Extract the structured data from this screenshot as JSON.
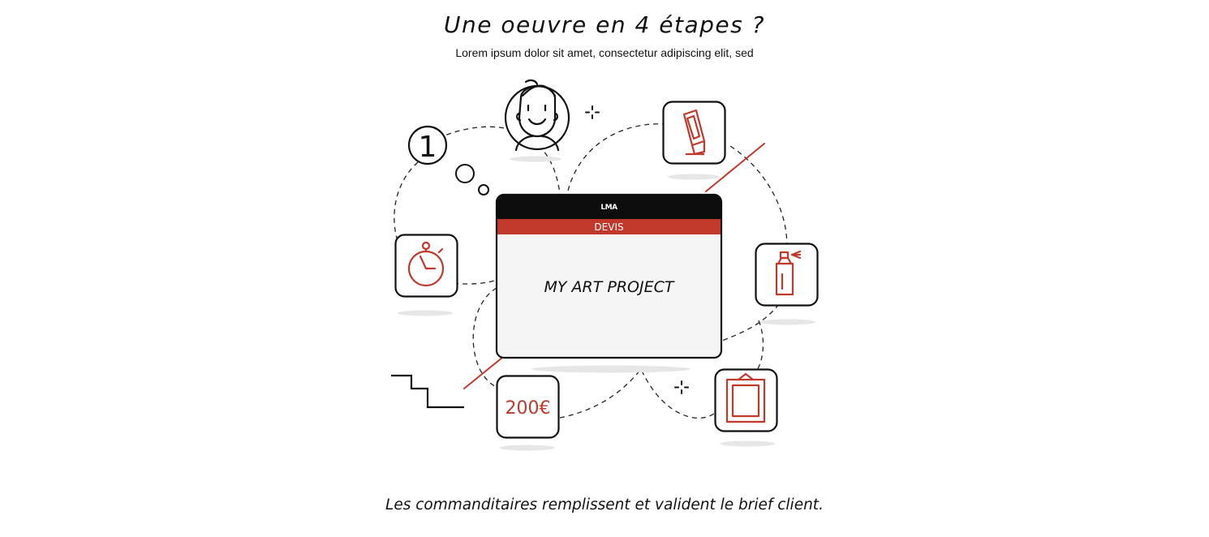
{
  "header": {
    "title": "Une oeuvre en 4 étapes ?",
    "subtitle": "Lorem ipsum dolor sit amet, consectetur adipiscing elit, sed"
  },
  "illustration": {
    "step_number": "1",
    "card": {
      "logo_text": "LMA",
      "tab_label": "DEVIS",
      "project_name": "MY ART PROJECT"
    },
    "price": "200€",
    "icons": [
      "person-avatar-icon",
      "thought-bubble-icon",
      "stopwatch-icon",
      "marker-pen-icon",
      "spray-can-icon",
      "picture-frame-icon",
      "staircase-icon",
      "sparkle-icon"
    ],
    "colors": {
      "accent": "#c0392b",
      "ink": "#111111",
      "card_bg": "#f5f5f5",
      "shadow": "#e6e6e6"
    }
  },
  "footer": {
    "caption": "Les commanditaires remplissent et valident le brief client."
  }
}
